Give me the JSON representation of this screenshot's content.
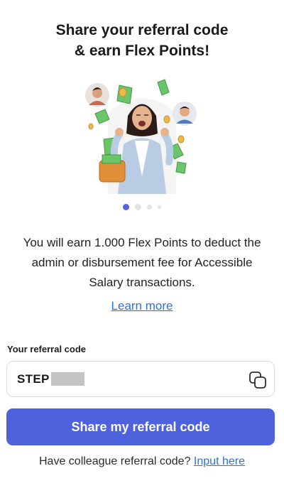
{
  "header": {
    "title_line1": "Share your referral code",
    "title_line2": "& earn Flex Points!"
  },
  "carousel": {
    "total_pages": 4,
    "active_page": 1
  },
  "description": "You will earn 1.000 Flex Points to deduct the admin or disbursement fee for Accessible Salary transactions.",
  "learn_more": "Learn more",
  "referral": {
    "label": "Your referral code",
    "code_visible": "STEP",
    "copy_icon": "copy-icon"
  },
  "share_button": "Share my referral code",
  "footer": {
    "prompt": "Have colleague referral code?",
    "link": "Input here"
  },
  "colors": {
    "primary": "#4f62de",
    "link": "#2f6fe0",
    "dot_active": "#5062de",
    "dot_inactive": "#e3e3e3"
  }
}
